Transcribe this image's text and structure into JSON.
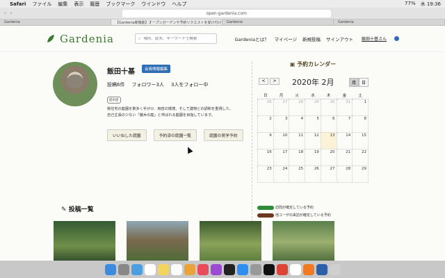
{
  "menubar": {
    "app": "Safari",
    "items": [
      "ファイル",
      "編集",
      "表示",
      "履歴",
      "ブックマーク",
      "ウインドウ",
      "ヘルプ"
    ],
    "battery": "77%",
    "day_time": "木 19:36"
  },
  "browser": {
    "url": "open-gardenia.com",
    "tabs": [
      "Gardenia",
      "【Gardenia新機能】オープンガーデンや予約リクエストを受け付けるページを…",
      "Gardenia",
      "Gardenia"
    ]
  },
  "header": {
    "logo": "Gardenia",
    "search_placeholder": "場所、庭木、キーワードで検索",
    "nav": [
      "Gardeniaとは？",
      "マイページ",
      "新規投稿",
      "サインアウト"
    ],
    "user": "飯田十基さん"
  },
  "profile": {
    "name": "飯田十基",
    "edit_button": "会員情報編集",
    "posts": "投稿6件",
    "followers": "フォロワー3人",
    "following": "3人をフォロー中",
    "tag": "庭木屋",
    "bio_line1": "撥住宅の庭園を数多く手がけ、雨容の環境、そして建物との調和を重視した、",
    "bio_line2": "自己主張の少ない「雑木の庭」と呼ばれる庭園を目指しています。",
    "buttons": [
      "いいねした庭園",
      "予約済の庭園一覧",
      "庭園の見学予約"
    ]
  },
  "calendar": {
    "title": "予約カレンダー",
    "prev": "<",
    "next": ">",
    "month": "2020年 2月",
    "view_month": "月",
    "view_day": "日",
    "weekdays": [
      "日",
      "月",
      "火",
      "水",
      "木",
      "金",
      "土"
    ],
    "weeks": [
      [
        "26",
        "27",
        "28",
        "29",
        "30",
        "31",
        "1"
      ],
      [
        "2",
        "3",
        "4",
        "5",
        "6",
        "7",
        "8"
      ],
      [
        "9",
        "10",
        "11",
        "12",
        "13",
        "14",
        "15"
      ],
      [
        "16",
        "17",
        "18",
        "19",
        "20",
        "21",
        "22"
      ],
      [
        "23",
        "24",
        "25",
        "26",
        "27",
        "28",
        "29"
      ]
    ],
    "legend_confirmed": "訪問が確定している予約",
    "legend_other": "他ユーザの来訪が確定している予約",
    "colors": {
      "confirmed": "#2e8b3a",
      "other": "#6b3a1e"
    }
  },
  "posts": {
    "title": "投稿一覧"
  }
}
